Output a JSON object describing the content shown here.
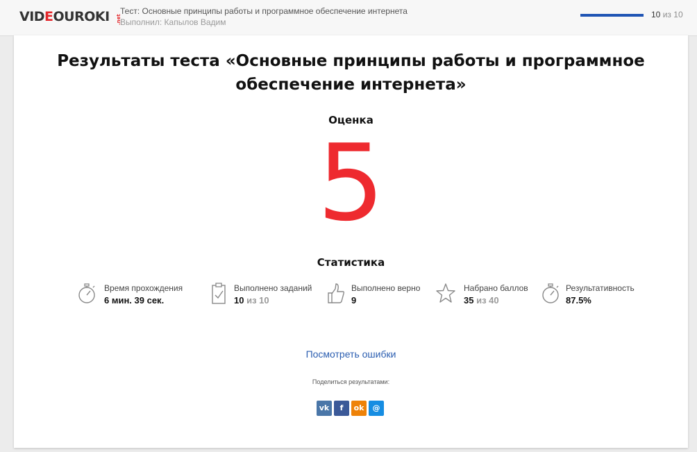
{
  "header": {
    "logo": {
      "part1": "VID",
      "accent": "E",
      "part2": "OUROKI",
      "tld": ".net"
    },
    "test_title": "Тест: Основные принципы работы и программное обеспечение интернета",
    "author": "Выполнил: Капылов Вадим",
    "progress_fraction": 1.0,
    "counter": {
      "current": "10",
      "of_word": "из",
      "total": "10"
    },
    "accent_color": "#1f54b4"
  },
  "result": {
    "title": "Результаты теста «Основные принципы работы и программное обеспечение интернета»",
    "grade_label": "Оценка",
    "grade_value": "5",
    "grade_color": "#ee2a2f",
    "stats_label": "Статистика",
    "stats": [
      {
        "icon": "stopwatch-icon",
        "label": "Время прохождения",
        "value": "6 мин. 39 сек.",
        "suffix": ""
      },
      {
        "icon": "clipboard-check-icon",
        "label": "Выполнено заданий",
        "value": "10",
        "suffix": "из 10"
      },
      {
        "icon": "thumbs-up-icon",
        "label": "Выполнено верно",
        "value": "9",
        "suffix": ""
      },
      {
        "icon": "star-icon",
        "label": "Набрано баллов",
        "value": "35",
        "suffix": "из 40"
      },
      {
        "icon": "stopwatch-icon",
        "label": "Результативность",
        "value": "87.5%",
        "suffix": ""
      }
    ],
    "mistakes_link": "Посмотреть ошибки",
    "share_label": "Поделиться результатами:",
    "share": [
      {
        "name": "vk",
        "glyph": "vk",
        "color": "#4a76a8"
      },
      {
        "name": "facebook",
        "glyph": "f",
        "color": "#3b5998"
      },
      {
        "name": "odnoklassniki",
        "glyph": "ok",
        "color": "#ee8208"
      },
      {
        "name": "moimir",
        "glyph": "@",
        "color": "#168de2"
      }
    ]
  }
}
